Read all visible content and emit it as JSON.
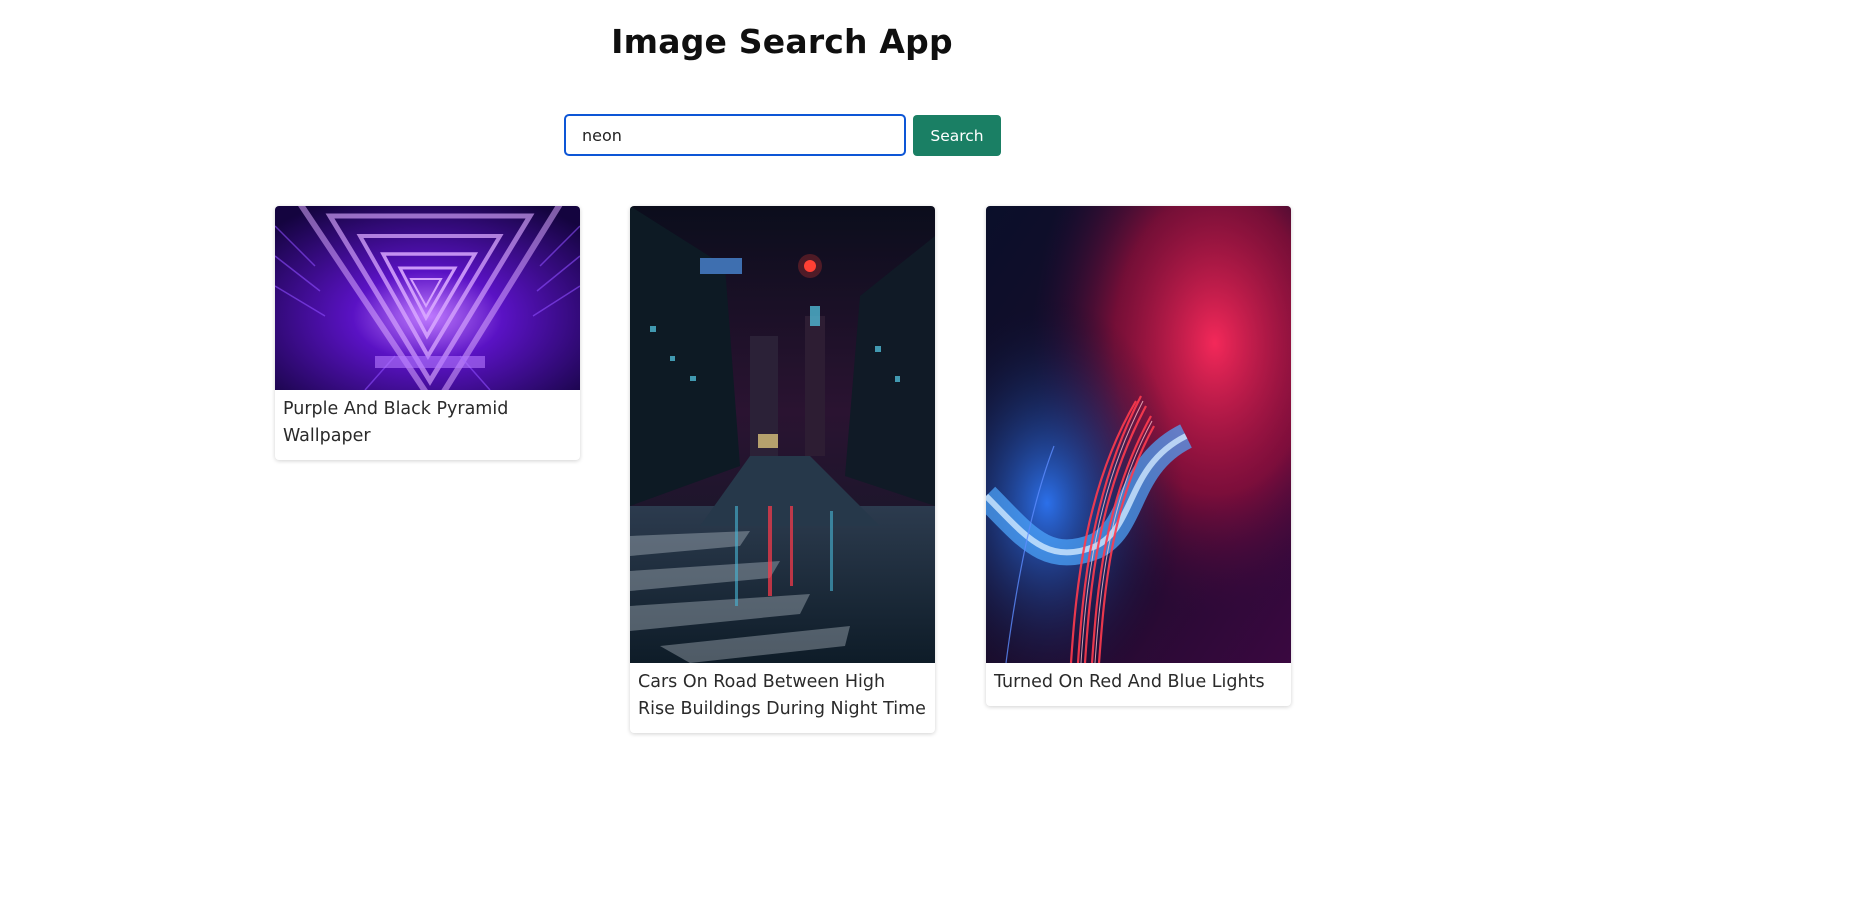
{
  "header": {
    "title": "Image Search App"
  },
  "search": {
    "value": "neon",
    "button_label": "Search"
  },
  "results": [
    {
      "caption": "Purple And Black Pyramid Wallpaper"
    },
    {
      "caption": "Cars On Road Between High Rise Buildings During Night Time"
    },
    {
      "caption": "Turned On Red And Blue Lights"
    }
  ],
  "colors": {
    "accent": "#1a7f64",
    "input_border": "#0d56d6"
  }
}
